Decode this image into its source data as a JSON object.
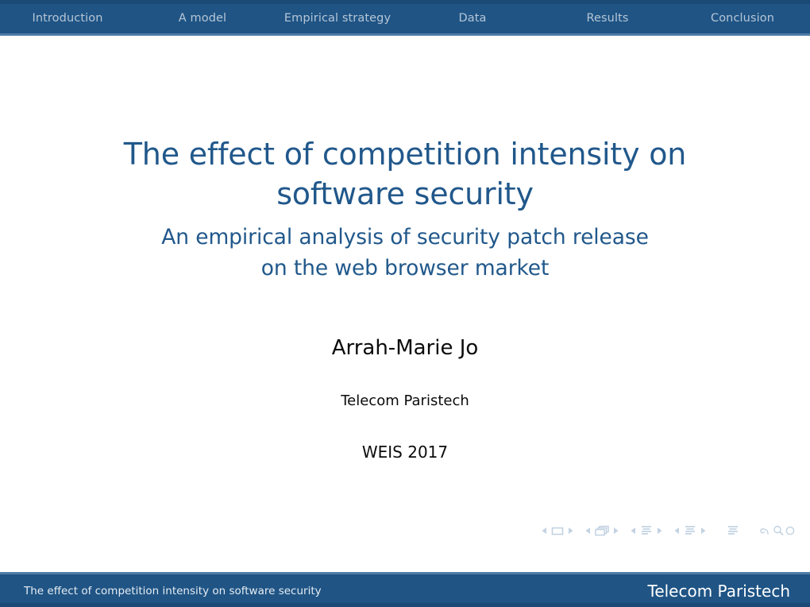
{
  "navbar": {
    "sections": [
      {
        "label": "Introduction"
      },
      {
        "label": "A model"
      },
      {
        "label": "Empirical strategy"
      },
      {
        "label": "Data"
      },
      {
        "label": "Results"
      },
      {
        "label": "Conclusion"
      }
    ],
    "background_color": "#1f5485",
    "text_color": "#b6c6d6"
  },
  "slide": {
    "title_line1": "The effect of competition intensity on",
    "title_line2": "software security",
    "subtitle_line1": "An empirical analysis of security patch release",
    "subtitle_line2": "on the web browser market",
    "author": "Arrah-Marie Jo",
    "institute": "Telecom Paristech",
    "date": "WEIS 2017",
    "title_color": "#21588b",
    "text_color": "#0b0b0b",
    "background_color": "#ffffff"
  },
  "nav_symbols": {
    "items": [
      {
        "name": "slide-prev-icon",
        "glyph": "triangle-left"
      },
      {
        "name": "slide-current-icon",
        "glyph": "square"
      },
      {
        "name": "slide-next-icon",
        "glyph": "triangle-right"
      },
      {
        "name": "frame-prev-icon",
        "glyph": "triangle-left"
      },
      {
        "name": "frame-current-icon",
        "glyph": "stacked-squares"
      },
      {
        "name": "frame-next-icon",
        "glyph": "triangle-right"
      },
      {
        "name": "subsection-prev-icon",
        "glyph": "triangle-left"
      },
      {
        "name": "subsection-current-icon",
        "glyph": "lines-block"
      },
      {
        "name": "subsection-next-icon",
        "glyph": "triangle-right"
      },
      {
        "name": "section-prev-icon",
        "glyph": "triangle-left"
      },
      {
        "name": "section-current-icon",
        "glyph": "lines-block"
      },
      {
        "name": "section-next-icon",
        "glyph": "triangle-right"
      },
      {
        "name": "presentation-icon",
        "glyph": "lines-block"
      },
      {
        "name": "back-icon",
        "glyph": "curved-arrow"
      },
      {
        "name": "search-icon",
        "glyph": "magnifier"
      },
      {
        "name": "goto-icon",
        "glyph": "circle"
      }
    ],
    "color": "#c2d2e2"
  },
  "footer": {
    "left_text": "The effect of competition intensity on software security",
    "right_text": "Telecom Paristech",
    "background_color": "#1f5485"
  }
}
